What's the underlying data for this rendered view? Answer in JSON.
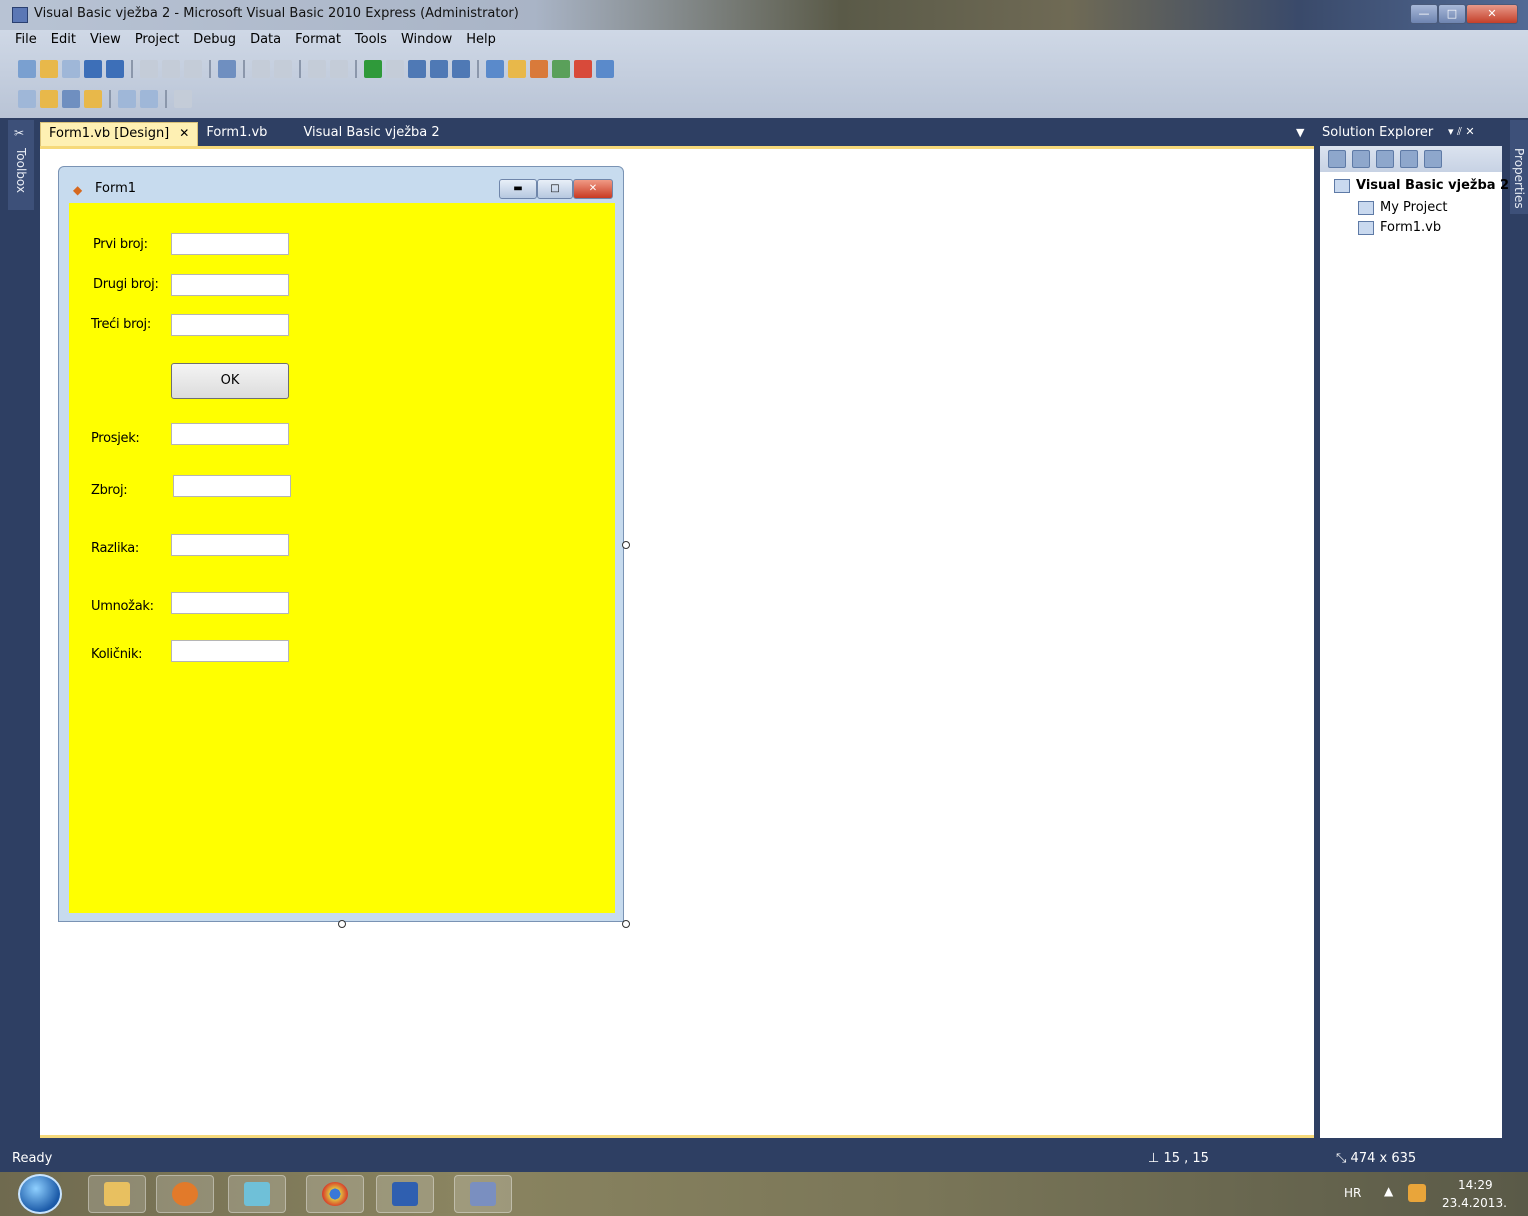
{
  "window": {
    "title": "Visual Basic vježba 2 - Microsoft Visual Basic 2010 Express (Administrator)"
  },
  "menu": [
    "File",
    "Edit",
    "View",
    "Project",
    "Debug",
    "Data",
    "Format",
    "Tools",
    "Window",
    "Help"
  ],
  "toolbox_label": "Toolbox",
  "properties_label": "Properties",
  "tabs": [
    {
      "label": "Form1.vb [Design]",
      "active": true
    },
    {
      "label": "Form1.vb",
      "active": false
    },
    {
      "label": "Visual Basic vježba 2",
      "active": false
    }
  ],
  "tab_close_glyph": "✕",
  "form": {
    "title": "Form1",
    "back_color": "#FFFF00",
    "labels": {
      "prvi": "Prvi broj:",
      "drugi": "Drugi broj:",
      "treci": "Treći broj:",
      "prosjek": "Prosjek:",
      "zbroj": "Zbroj:",
      "razlika": "Razlika:",
      "umnozak": "Umnožak:",
      "kolicnik": "Količnik:"
    },
    "ok_button": "OK"
  },
  "solution_explorer": {
    "title": "Solution Explorer",
    "controls": "▾ ⫽ ✕",
    "tree": {
      "root": "Visual Basic vježba 2",
      "children": [
        "My Project",
        "Form1.vb"
      ]
    }
  },
  "status": {
    "left": "Ready",
    "position": "15 , 15",
    "size": "474 x 635"
  },
  "tray": {
    "language": "HR",
    "time": "14:29",
    "date": "23.4.2013."
  },
  "colors": {
    "ide_background": "#2E3F63",
    "active_tab": "#FEF0B3",
    "form_client": "#FFFF00"
  }
}
